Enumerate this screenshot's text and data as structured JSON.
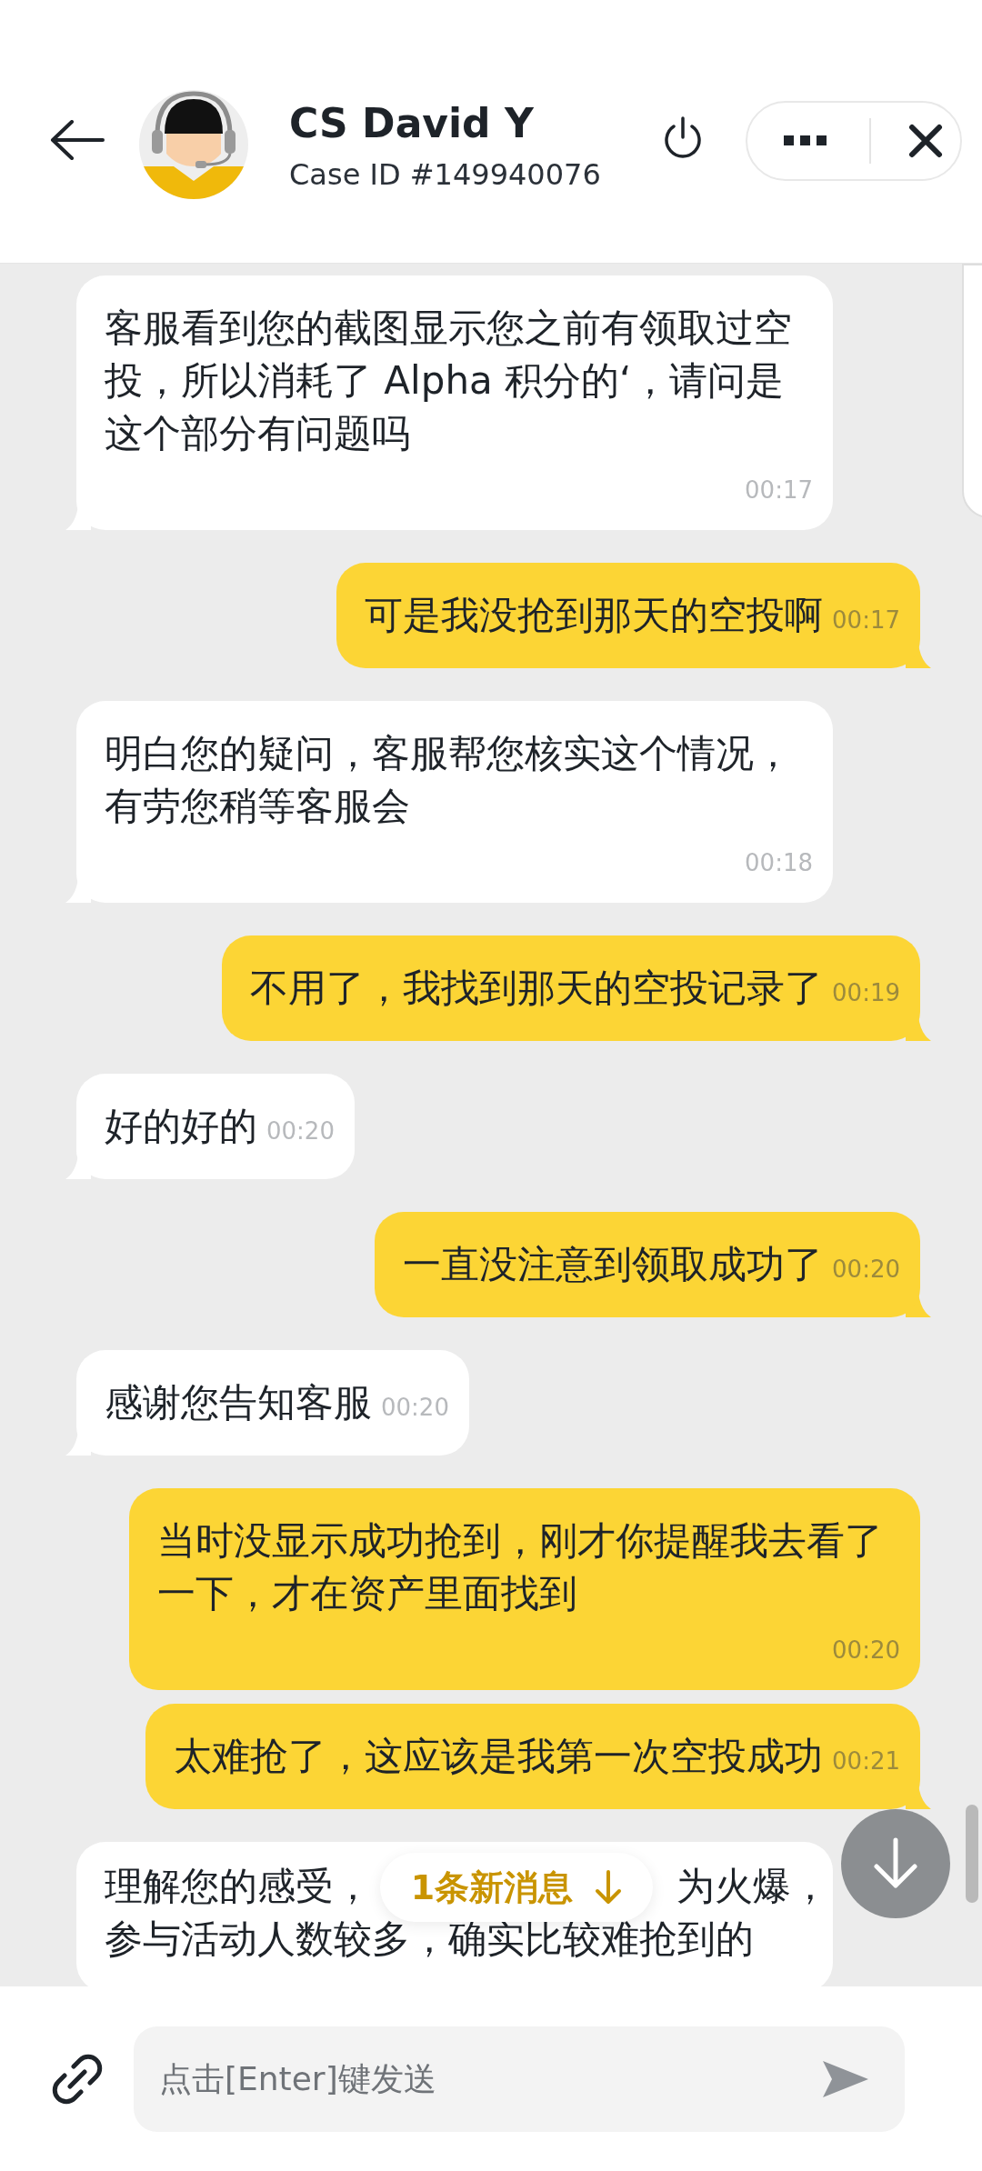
{
  "header": {
    "title": "CS David Y",
    "subtitle": "Case ID #149940076"
  },
  "messages": [
    {
      "kind": "agent",
      "text": "客服看到您的截图显示您之前有领取过空投，所以消耗了 Alpha 积分的‘，请问是这个部分有问题吗",
      "time": "00:17",
      "tail": true
    },
    {
      "kind": "user",
      "text": "可是我没抢到那天的空投啊",
      "time": "00:17",
      "tail": true
    },
    {
      "kind": "agent",
      "text": "明白您的疑问，客服帮您核实这个情况，有劳您稍等客服会",
      "time": "00:18",
      "tail": true
    },
    {
      "kind": "user",
      "text": "不用了，我找到那天的空投记录了",
      "time": "00:19",
      "tail": true
    },
    {
      "kind": "agent",
      "text": "好的好的",
      "time": "00:20",
      "tail": true
    },
    {
      "kind": "user",
      "text": "一直没注意到领取成功了",
      "time": "00:20",
      "tail": true
    },
    {
      "kind": "agent",
      "text": "感谢您告知客服",
      "time": "00:20",
      "tail": true
    },
    {
      "kind": "user",
      "text": "当时没显示成功抢到，刚才你提醒我去看了一下，才在资产里面找到",
      "time": "00:20",
      "tail": false
    },
    {
      "kind": "user",
      "text": "太难抢了，这应该是我第一次空投成功",
      "time": "00:21",
      "tail": true
    },
    {
      "kind": "agent",
      "lines": [
        [
          "理解您的感受，",
          "为火爆，"
        ],
        [
          "参与活动人数较多，确实比较难抢到的"
        ]
      ]
    }
  ],
  "new_messages": {
    "label": "1条新消息"
  },
  "composer": {
    "placeholder": "点击[Enter]键发送"
  }
}
